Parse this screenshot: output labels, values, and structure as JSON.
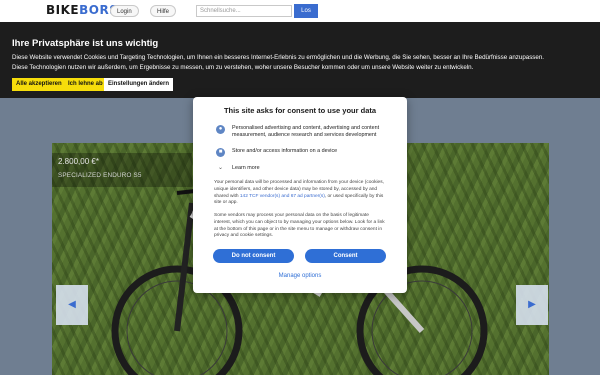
{
  "header": {
    "logo_main": "BIKE",
    "logo_accent": "BORSE",
    "login_label": "Login",
    "help_label": "Hilfe",
    "search_placeholder": "Schnellsuche...",
    "search_button": "Los"
  },
  "cookie_banner": {
    "title": "Ihre Privatsphäre ist uns wichtig",
    "text_line1": "Diese Website verwendet Cookies und Targeting Technologien, um Ihnen ein besseres Internet-Erlebnis zu ermöglichen und die Werbung, die Sie sehen, besser an Ihre Bedürfnisse anzupassen.",
    "text_line2": "Diese Technologien nutzen wir außerdem, um Ergebnisse zu messen, um zu verstehen, woher unsere Besucher kommen oder um unsere Website weiter zu entwickeln.",
    "accept_label": "Alle akzeptieren",
    "decline_label": "Ich lehne ab",
    "settings_label": "Einstellungen ändern"
  },
  "listing": {
    "price": "2.800,00 €*",
    "title": "SPECIALIZED ENDURO S5",
    "prev_label": "◀",
    "next_label": "▶"
  },
  "consent_modal": {
    "title": "This site asks for consent to use your data",
    "purposes": [
      {
        "icon": "person-icon",
        "label": "Personalised advertising and content, advertising and content measurement, audience research and services development"
      },
      {
        "icon": "device-icon",
        "label": "Store and/or access information on a device"
      }
    ],
    "learn_more": "Learn more",
    "body_pre": "Your personal data will be processed and information from your device (cookies, unique identifiers, and other device data) may be stored by, accessed by and shared with ",
    "body_link": "142 TCF vendor(s) and 67 ad partner(s)",
    "body_post": ", or used specifically by this site or app.",
    "body2": "Some vendors may process your personal data on the basis of legitimate interest, which you can object to by managing your options below. Look for a link at the bottom of this page or in the site menu to manage or withdraw consent in privacy and cookie settings.",
    "do_not_consent": "Do not consent",
    "consent": "Consent",
    "manage_options": "Manage options"
  }
}
